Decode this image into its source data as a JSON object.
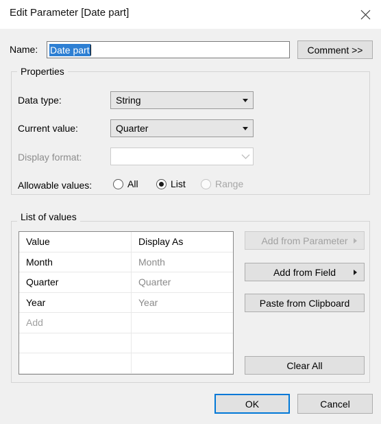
{
  "window": {
    "title": "Edit Parameter [Date part]",
    "close_icon": "close-icon"
  },
  "name_row": {
    "label": "Name:",
    "value": "Date part",
    "comment_button": "Comment >>"
  },
  "properties": {
    "legend": "Properties",
    "data_type": {
      "label": "Data type:",
      "value": "String"
    },
    "current_value": {
      "label": "Current value:",
      "value": "Quarter"
    },
    "display_format": {
      "label": "Display format:",
      "value": "",
      "disabled": true
    },
    "allowable_values": {
      "label": "Allowable values:",
      "options": [
        {
          "label": "All",
          "selected": false,
          "disabled": false
        },
        {
          "label": "List",
          "selected": true,
          "disabled": false
        },
        {
          "label": "Range",
          "selected": false,
          "disabled": true
        }
      ]
    }
  },
  "list_of_values": {
    "legend": "List of values",
    "columns": [
      "Value",
      "Display As"
    ],
    "rows": [
      {
        "value": "Month",
        "display_as": "Month"
      },
      {
        "value": "Quarter",
        "display_as": "Quarter"
      },
      {
        "value": "Year",
        "display_as": "Year"
      }
    ],
    "add_placeholder": "Add",
    "buttons": {
      "add_from_parameter": "Add from Parameter",
      "add_from_field": "Add from Field",
      "paste_from_clipboard": "Paste from Clipboard",
      "clear_all": "Clear All"
    }
  },
  "footer": {
    "ok": "OK",
    "cancel": "Cancel"
  },
  "colors": {
    "accent": "#0078d7",
    "selection": "#2d7fd3",
    "surface": "#f0f0f0",
    "button_face": "#e1e1e1"
  }
}
